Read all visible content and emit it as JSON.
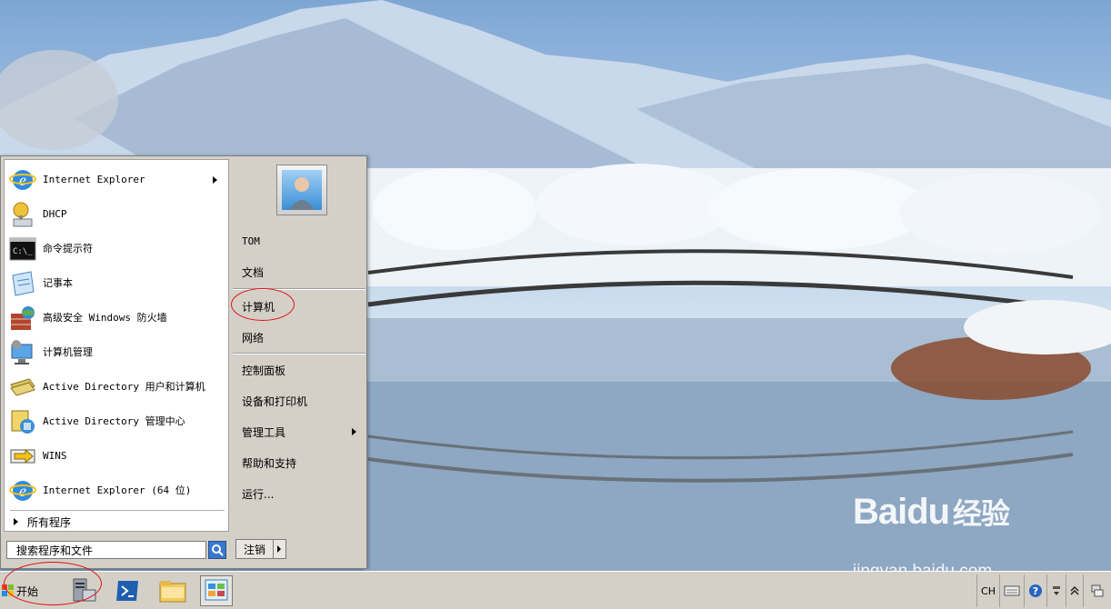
{
  "start_menu": {
    "programs": [
      {
        "label": "Internet Explorer",
        "icon": "internet-explorer-icon",
        "has_submenu": true
      },
      {
        "label": "DHCP",
        "icon": "dhcp-icon"
      },
      {
        "label": "命令提示符",
        "icon": "command-prompt-icon"
      },
      {
        "label": "记事本",
        "icon": "notepad-icon"
      },
      {
        "label": "高级安全 Windows 防火墙",
        "icon": "firewall-icon"
      },
      {
        "label": "计算机管理",
        "icon": "computer-management-icon"
      },
      {
        "label": "Active Directory 用户和计算机",
        "icon": "ad-users-icon"
      },
      {
        "label": "Active Directory 管理中心",
        "icon": "ad-admin-center-icon"
      },
      {
        "label": "WINS",
        "icon": "wins-icon"
      },
      {
        "label": "Internet Explorer (64 位)",
        "icon": "internet-explorer-64-icon"
      }
    ],
    "all_programs": "所有程序",
    "search_placeholder": "搜索程序和文件",
    "user_name": "TOM",
    "right_items": [
      {
        "label": "文档"
      },
      {
        "label": "计算机"
      },
      {
        "label": "网络"
      },
      {
        "label": "控制面板"
      },
      {
        "label": "设备和打印机"
      },
      {
        "label": "管理工具",
        "has_submenu": true
      },
      {
        "label": "帮助和支持"
      },
      {
        "label": "运行..."
      }
    ],
    "logoff": "注销"
  },
  "taskbar": {
    "start_label": "开始",
    "pinned": [
      "server-manager-icon",
      "powershell-icon",
      "explorer-folder-icon",
      "control-panel-icon"
    ],
    "tray": {
      "language": "CH"
    }
  },
  "watermark": {
    "brand": "Baidu",
    "brand_cn": "经验",
    "url": "jingyan.baidu.com"
  },
  "colors": {
    "annotation": "#dd1111",
    "menu_bg": "#d4d0c8"
  }
}
